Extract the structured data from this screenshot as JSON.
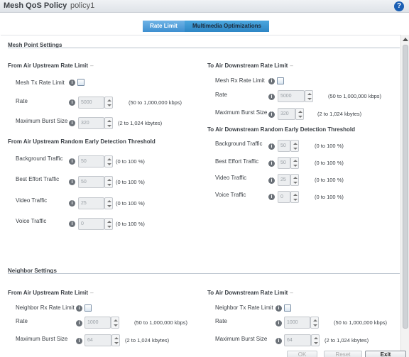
{
  "header": {
    "title": "Mesh QoS Policy",
    "policy_name": "policy1",
    "help_label": "?"
  },
  "tabs": [
    {
      "label": "Rate Limit",
      "active": true
    },
    {
      "label": "Multimedia Optimizations",
      "active": false
    }
  ],
  "mesh_point": {
    "title": "Mesh Point Settings",
    "upstream_rate": {
      "title": "From Air Upstream Rate Limit",
      "enable_label": "Mesh Tx Rate Limit",
      "rate_label": "Rate",
      "rate_value": "5000",
      "rate_hint": "(50 to 1,000,000 kbps)",
      "burst_label": "Maximum Burst Size",
      "burst_value": "320",
      "burst_hint": "(2 to 1,024 kbytes)"
    },
    "downstream_rate": {
      "title": "To Air Downstream Rate Limit",
      "enable_label": "Mesh Rx Rate Limit",
      "rate_label": "Rate",
      "rate_value": "5000",
      "rate_hint": "(50 to 1,000,000 kbps)",
      "burst_label": "Maximum Burst Size",
      "burst_value": "320",
      "burst_hint": "(2 to 1,024 kbytes)"
    },
    "upstream_red": {
      "title": "From Air Upstream Random Early Detection Threshold",
      "rows": [
        {
          "label": "Background Traffic",
          "value": "50",
          "hint": "(0 to 100 %)"
        },
        {
          "label": "Best Effort Traffic",
          "value": "50",
          "hint": "(0 to 100 %)"
        },
        {
          "label": "Video Traffic",
          "value": "25",
          "hint": "(0 to 100 %)"
        },
        {
          "label": "Voice Traffic",
          "value": "0",
          "hint": "(0 to 100 %)"
        }
      ]
    },
    "downstream_red": {
      "title": "To Air Downstream Random Early Detection Threshold",
      "rows": [
        {
          "label": "Background Traffic",
          "value": "50",
          "hint": "(0 to 100 %)"
        },
        {
          "label": "Best Effort Traffic",
          "value": "50",
          "hint": "(0 to 100 %)"
        },
        {
          "label": "Video Traffic",
          "value": "25",
          "hint": "(0 to 100 %)"
        },
        {
          "label": "Voice Traffic",
          "value": "0",
          "hint": "(0 to 100 %)"
        }
      ]
    }
  },
  "neighbor": {
    "title": "Neighbor Settings",
    "upstream_rate": {
      "title": "From Air Upstream Rate Limit",
      "enable_label": "Neighbor Rx Rate Limit",
      "rate_label": "Rate",
      "rate_value": "1000",
      "rate_hint": "(50 to 1,000,000 kbps)",
      "burst_label": "Maximum Burst Size",
      "burst_value": "64",
      "burst_hint": "(2 to 1,024 kbytes)"
    },
    "downstream_rate": {
      "title": "To Air Downstream Rate Limit",
      "enable_label": "Neighbor Tx Rate Limit",
      "rate_label": "Rate",
      "rate_value": "1000",
      "rate_hint": "(50 to 1,000,000 kbps)",
      "burst_label": "Maximum Burst Size",
      "burst_value": "64",
      "burst_hint": "(2 to 1,024 kbytes)"
    }
  },
  "info_glyph": "i",
  "footer": {
    "ok_label": "OK",
    "reset_label": "Reset",
    "exit_label": "Exit"
  }
}
